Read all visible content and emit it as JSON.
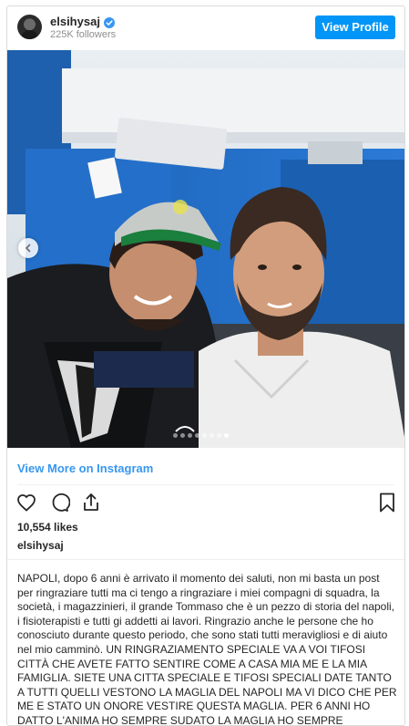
{
  "profile": {
    "username": "elsihysaj",
    "followers": "225K followers",
    "view_profile_label": "View Profile"
  },
  "photo": {
    "carousel_total": 8,
    "carousel_active_index": 7
  },
  "view_more_label": "View More on Instagram",
  "likes": "10,554 likes",
  "caption_username": "elsihysaj",
  "caption_text": "NAPOLI, dopo 6 anni è arrivato il momento dei saluti, non mi basta un post per ringraziare tutti ma ci tengo a ringraziare i miei compagni di squadra, la società, i magazzinieri, il grande Tommaso che è un pezzo di storia del napoli, i fisioterapisti e tutti gi addetti ai lavori. Ringrazio anche le persone che ho conosciuto durante questo periodo, che sono stati tutti meravigliosi e di aiuto nel mio camminò. UN RINGRAZIAMENTO SPECIALE VA A VOI TIFOSI CITTÀ CHE AVETE FATTO SENTIRE COME A CASA MIA ME E LA MIA FAMIGLIA. SIETE UNA CITTA SPECIALE E TIFOSI SPECIALI DATE TANTO A TUTTI QUELLI VESTONO LA MAGLIA DEL NAPOLI MA VI DICO CHE PER ME E STATO UN ONORE VESTIRE QUESTA MAGLIA. PER 6 ANNI HO DATTO L'ANIMA HO SEMPRE SUDATO LA MAGLIA HO SEMPRE CERCATO DI",
  "colors": {
    "accent": "#0095f6",
    "link": "#3897f0",
    "text": "#262626",
    "muted": "#8e8e8e",
    "border": "#dbdbdb"
  },
  "icons": [
    "verified-badge-icon",
    "chevron-left-icon",
    "heart-icon",
    "comment-icon",
    "share-icon",
    "bookmark-icon"
  ]
}
